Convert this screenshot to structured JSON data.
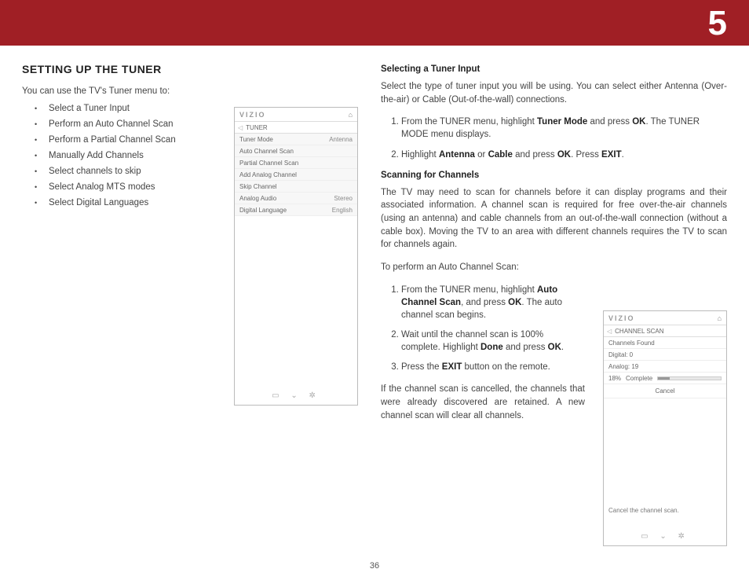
{
  "header": {
    "chapter": "5"
  },
  "left": {
    "heading": "SETTING UP THE TUNER",
    "intro": "You can use the TV's Tuner menu to:",
    "bullets": [
      "Select a Tuner Input",
      "Perform an Auto Channel Scan",
      "Perform a Partial Channel Scan",
      "Manually Add Channels",
      "Select channels to skip",
      "Select Analog MTS modes",
      "Select Digital Languages"
    ]
  },
  "tv1": {
    "logo": "VIZIO",
    "title": "TUNER",
    "rows": [
      {
        "label": "Tuner Mode",
        "value": "Antenna"
      },
      {
        "label": "Auto Channel Scan",
        "value": ""
      },
      {
        "label": "Partial Channel Scan",
        "value": ""
      },
      {
        "label": "Add Analog Channel",
        "value": ""
      },
      {
        "label": "Skip Channel",
        "value": ""
      },
      {
        "label": "Analog Audio",
        "value": "Stereo"
      },
      {
        "label": "Digital Language",
        "value": "English"
      }
    ]
  },
  "tv2": {
    "logo": "VIZIO",
    "title": "CHANNEL SCAN",
    "found_label": "Channels Found",
    "digital": "Digital:   0",
    "analog": "Analog: 19",
    "percent": "18%",
    "complete": "Complete",
    "cancel": "Cancel",
    "note": "Cancel the channel scan."
  },
  "right": {
    "selecting_h": "Selecting a Tuner Input",
    "selecting_p": "Select the type of tuner input you will be using. You can select either Antenna (Over-the-air) or Cable (Out-of-the-wall) connections.",
    "sel_step1a": "From the TUNER menu, highlight ",
    "sel_step1b": " and press ",
    "sel_step1c": ". The TUNER MODE menu displays.",
    "sel_step2a": "Highlight ",
    "sel_step2b": " or ",
    "sel_step2c": " and press ",
    "sel_step2d": ". Press ",
    "sel_step2e": ".",
    "bold": {
      "tuner_mode": "Tuner Mode",
      "ok": "OK",
      "antenna": "Antenna",
      "cable": "Cable",
      "exit": "EXIT",
      "acs": "Auto Channel Scan",
      "done": "Done"
    },
    "scanning_h": "Scanning for Channels",
    "scanning_p": "The TV may need to scan for channels before it can display programs and their associated information. A channel scan is required for free over-the-air channels (using an antenna) and cable channels from an out-of-the-wall connection (without a cable box). Moving the TV to an area with different channels requires the TV to scan for channels again.",
    "scan_intro": "To perform an Auto Channel Scan:",
    "scan1a": "From the TUNER menu, highlight ",
    "scan1b": ", and press ",
    "scan1c": ". The auto channel scan begins.",
    "scan2a": "Wait until the channel scan is 100% complete. Highlight ",
    "scan2b": " and press ",
    "scan2c": ".",
    "scan3a": "Press the ",
    "scan3b": " button on the remote.",
    "cancel_p": "If the channel scan is cancelled, the channels that were already discovered are retained. A new channel scan will clear all channels."
  },
  "page_number": "36"
}
